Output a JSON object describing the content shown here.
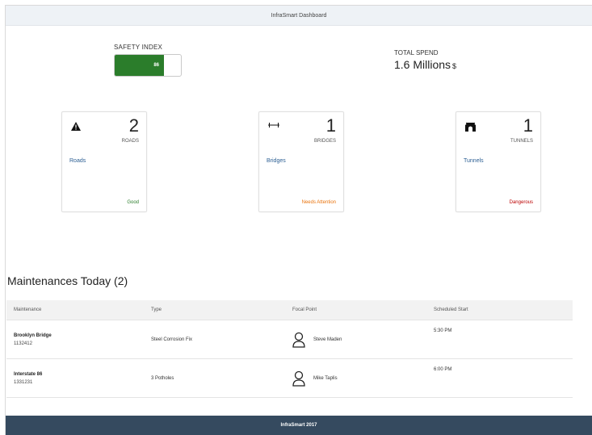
{
  "header": {
    "title": "InfraSmart Dashboard"
  },
  "kpis": {
    "safety_label": "SAFETY INDEX",
    "safety_value": "86",
    "safety_level": 0.74,
    "safety_color": "#2b7d2b",
    "spend_label": "TOTAL SPEND",
    "spend_value": "1.6 Millions",
    "spend_unit": "$"
  },
  "tiles": [
    {
      "icon": "warning-triangle-icon",
      "count": "2",
      "unit": "ROADS",
      "name": "Roads",
      "status": "Good",
      "status_color": "#2b7d2b"
    },
    {
      "icon": "bridge-icon",
      "count": "1",
      "unit": "BRIDGES",
      "name": "Bridges",
      "status": "Needs Attention",
      "status_color": "#e9730c"
    },
    {
      "icon": "tunnel-icon",
      "count": "1",
      "unit": "TUNNELS",
      "name": "Tunnels",
      "status": "Dangerous",
      "status_color": "#bb0000"
    }
  ],
  "maintenance": {
    "title": "Maintenances Today (2)",
    "columns": [
      "Maintenance",
      "Type",
      "Focal Point",
      "Scheduled Start"
    ],
    "rows": [
      {
        "name": "Brooklyn Bridge",
        "id": "1132412",
        "type": "Steel Corrosion Fix",
        "focal": "Steve Maden",
        "start": "5:30 PM"
      },
      {
        "name": "Interstate 86",
        "id": "1331231",
        "type": "3 Potholes",
        "focal": "Mike Taplis",
        "start": "6:00 PM"
      }
    ]
  },
  "footer": {
    "text": "InfraSmart 2017"
  }
}
